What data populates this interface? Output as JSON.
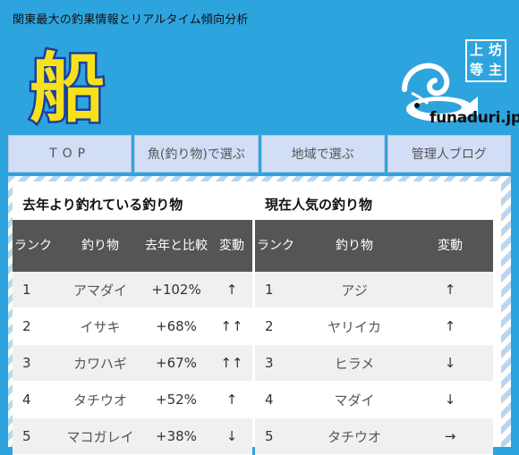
{
  "header": {
    "tagline": "関東最大の釣果情報とリアルタイム傾向分析",
    "logo_text": "船",
    "stamp_chars": [
      "上",
      "坊",
      "等",
      "主"
    ],
    "domain": "funaduri.jp"
  },
  "nav": {
    "items": [
      "TOP",
      "魚(釣り物)で選ぶ",
      "地域で選ぶ",
      "管理人ブログ"
    ]
  },
  "left_section": {
    "title": "去年より釣れている釣り物",
    "headers": [
      "ランク",
      "釣り物",
      "去年と比較",
      "変動"
    ],
    "rows": [
      {
        "rank": "1",
        "fish": "アマダイ",
        "compare": "+102%",
        "trend": "↑"
      },
      {
        "rank": "2",
        "fish": "イサキ",
        "compare": "+68%",
        "trend": "↑↑"
      },
      {
        "rank": "3",
        "fish": "カワハギ",
        "compare": "+67%",
        "trend": "↑↑"
      },
      {
        "rank": "4",
        "fish": "タチウオ",
        "compare": "+52%",
        "trend": "↑"
      },
      {
        "rank": "5",
        "fish": "マコガレイ",
        "compare": "+38%",
        "trend": "↓"
      }
    ]
  },
  "right_section": {
    "title": "現在人気の釣り物",
    "headers": [
      "ランク",
      "釣り物",
      "変動"
    ],
    "rows": [
      {
        "rank": "1",
        "fish": "アジ",
        "trend": "↑"
      },
      {
        "rank": "2",
        "fish": "ヤリイカ",
        "trend": "↑"
      },
      {
        "rank": "3",
        "fish": "ヒラメ",
        "trend": "↓"
      },
      {
        "rank": "4",
        "fish": "マダイ",
        "trend": "↓"
      },
      {
        "rank": "5",
        "fish": "タチウオ",
        "trend": "→"
      }
    ]
  },
  "colors": {
    "background": "#2ea4de",
    "logo_yellow": "#f7e21a",
    "logo_blue": "#1b3fa0",
    "nav_bg": "#d2ddf6",
    "table_header": "#555555"
  }
}
